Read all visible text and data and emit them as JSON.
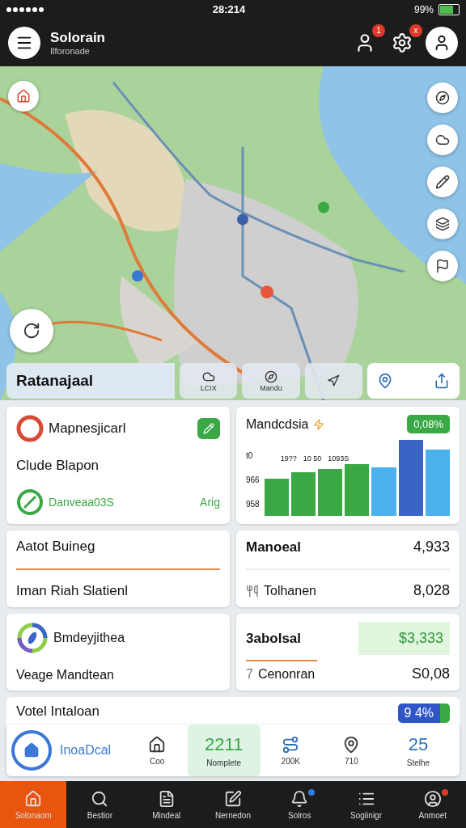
{
  "status_bar": {
    "time": "28:214",
    "battery_text": "99%"
  },
  "header": {
    "title": "Solorain",
    "subtitle": "Ilforonade",
    "badges": [
      "1",
      "x"
    ]
  },
  "map_toolbar": {
    "title": "Ratanajaal",
    "tabs": [
      {
        "label": "LCIX",
        "selected": false
      },
      {
        "label": "Mandu",
        "selected": false
      },
      {
        "selected": false
      },
      {
        "selected": true
      }
    ]
  },
  "cards": [
    {
      "kind": "status",
      "title": "Mapnesjicarl",
      "subtitle": "Clude Blapon",
      "status": "Danveaa03S",
      "status_right": "Arig"
    },
    {
      "kind": "chart",
      "title": "Mandcdsia",
      "badge": "0,08%",
      "axis_labels": [
        "t0",
        "966",
        "958"
      ],
      "bar_labels": [
        "19??",
        "10 50",
        "1093S"
      ]
    },
    {
      "kind": "text",
      "title": "Aatot Buineg",
      "subtitle": "Iman Riah Slatienl"
    },
    {
      "kind": "values",
      "title": "Manoeal",
      "value": "4,933",
      "row_label": "Tolhanen",
      "row_value": "8,028"
    },
    {
      "kind": "ring",
      "title": "Bmdeyjithea",
      "subtitle": "Veage Mandtean"
    },
    {
      "kind": "highlight",
      "title": "3abolsal",
      "value": "$3,333",
      "row_prefix": "7",
      "row_label": "Cenonran",
      "row_value": "S0,08"
    }
  ],
  "bottom_card": {
    "title": "Votel Intaloan",
    "badge": "9 4%"
  },
  "stats_bar": [
    {
      "kind": "brand",
      "label": "InoaDcal"
    },
    {
      "kind": "icon",
      "label": "Coo",
      "selected": false
    },
    {
      "kind": "value",
      "value": "2211",
      "label": "Nomplete",
      "selected": true
    },
    {
      "kind": "icon",
      "label": "200K",
      "selected": false
    },
    {
      "kind": "icon",
      "label": "710",
      "selected": false
    },
    {
      "kind": "value",
      "value": "25",
      "label": "Stelhe",
      "selected": false
    }
  ],
  "nav": [
    {
      "label": "Solonaom",
      "selected": true
    },
    {
      "label": "Bestior",
      "selected": false
    },
    {
      "label": "Mindeal",
      "selected": false
    },
    {
      "label": "Nernedon",
      "selected": false
    },
    {
      "label": "Solros",
      "selected": false,
      "color": "#2f7fe0"
    },
    {
      "label": "Sogiinigr",
      "selected": false
    },
    {
      "label": "Anmoet",
      "selected": false,
      "color": "#e0392b"
    }
  ]
}
